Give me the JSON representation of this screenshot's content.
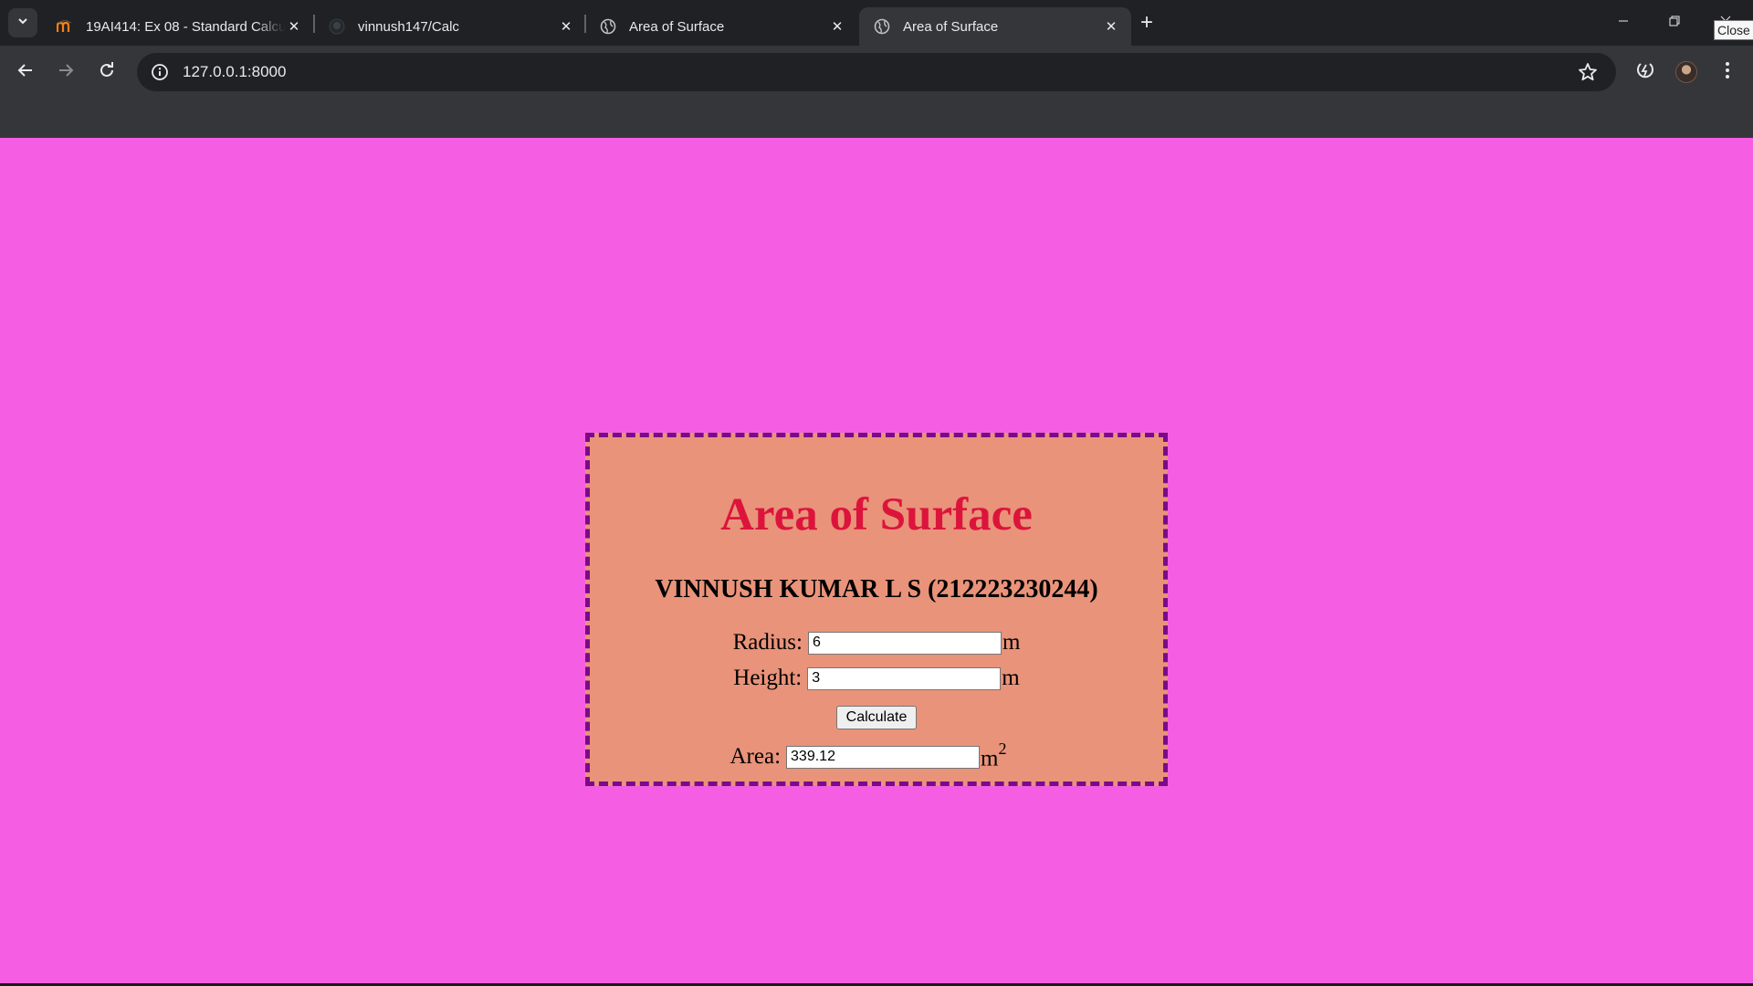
{
  "browser": {
    "tabs": [
      {
        "title": "19AI414: Ex 08 - Standard Calcu",
        "favicon": "moodle-icon",
        "active": false
      },
      {
        "title": "vinnush147/Calc",
        "favicon": "github-icon",
        "active": false
      },
      {
        "title": "Area of Surface",
        "favicon": "globe-icon",
        "active": false
      },
      {
        "title": "Area of Surface",
        "favicon": "globe-icon",
        "active": true
      }
    ],
    "address_bar": {
      "url": "127.0.0.1:8000"
    },
    "tooltip": "Close"
  },
  "page": {
    "title": "Area of Surface",
    "author": "VINNUSH KUMAR L S (212223230244)",
    "radius": {
      "label": "Radius:",
      "value": "6",
      "unit": "m"
    },
    "height": {
      "label": "Height:",
      "value": "3",
      "unit": "m"
    },
    "calculate_label": "Calculate",
    "area": {
      "label": "Area:",
      "value": "339.12",
      "unit": "m",
      "unit_sup": "2"
    },
    "colors": {
      "background": "#f55ee3",
      "card": "#e9937a",
      "border": "#7a0a8a",
      "title": "#dc143c"
    }
  }
}
